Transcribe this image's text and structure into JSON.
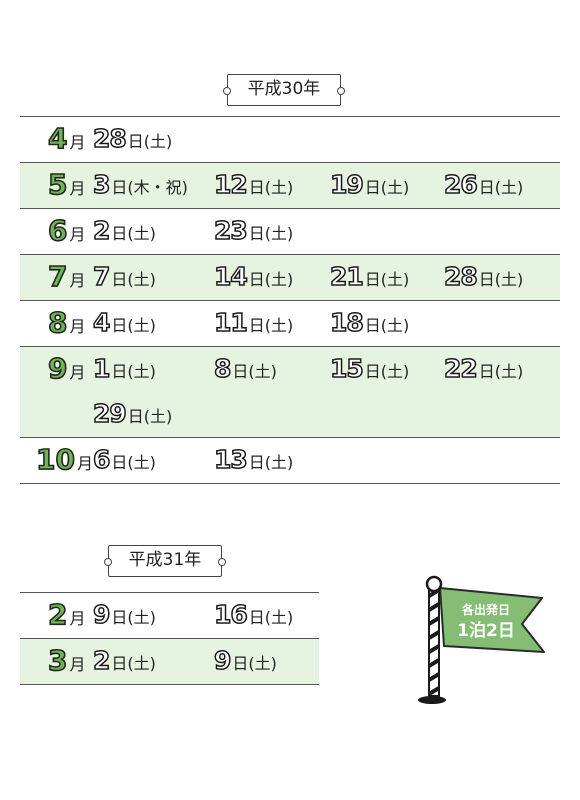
{
  "sections": [
    {
      "label": "平成30年",
      "rows": [
        {
          "month": "4",
          "month_suffix": "月",
          "shaded": false,
          "lines": [
            [
              {
                "day": "28",
                "suffix": "日(土)"
              }
            ]
          ]
        },
        {
          "month": "5",
          "month_suffix": "月",
          "shaded": true,
          "lines": [
            [
              {
                "day": "3",
                "suffix": "日(木・祝)"
              },
              {
                "day": "12",
                "suffix": "日(土)"
              },
              {
                "day": "19",
                "suffix": "日(土)"
              },
              {
                "day": "26",
                "suffix": "日(土)"
              }
            ]
          ]
        },
        {
          "month": "6",
          "month_suffix": "月",
          "shaded": false,
          "lines": [
            [
              {
                "day": "2",
                "suffix": "日(土)"
              },
              {
                "day": "23",
                "suffix": "日(土)"
              }
            ]
          ]
        },
        {
          "month": "7",
          "month_suffix": "月",
          "shaded": true,
          "lines": [
            [
              {
                "day": "7",
                "suffix": "日(土)"
              },
              {
                "day": "14",
                "suffix": "日(土)"
              },
              {
                "day": "21",
                "suffix": "日(土)"
              },
              {
                "day": "28",
                "suffix": "日(土)"
              }
            ]
          ]
        },
        {
          "month": "8",
          "month_suffix": "月",
          "shaded": false,
          "lines": [
            [
              {
                "day": "4",
                "suffix": "日(土)"
              },
              {
                "day": "11",
                "suffix": "日(土)"
              },
              {
                "day": "18",
                "suffix": "日(土)"
              }
            ]
          ]
        },
        {
          "month": "9",
          "month_suffix": "月",
          "shaded": true,
          "lines": [
            [
              {
                "day": "1",
                "suffix": "日(土)"
              },
              {
                "day": "8",
                "suffix": "日(土)"
              },
              {
                "day": "15",
                "suffix": "日(土)"
              },
              {
                "day": "22",
                "suffix": "日(土)"
              }
            ],
            [
              {
                "day": "29",
                "suffix": "日(土)"
              }
            ]
          ]
        },
        {
          "month": "10",
          "month_suffix": "月",
          "shaded": false,
          "lines": [
            [
              {
                "day": "6",
                "suffix": "日(土)"
              },
              {
                "day": "13",
                "suffix": "日(土)"
              }
            ]
          ]
        }
      ]
    },
    {
      "label": "平成31年",
      "rows": [
        {
          "month": "2",
          "month_suffix": "月",
          "shaded": false,
          "lines": [
            [
              {
                "day": "9",
                "suffix": "日(土)"
              },
              {
                "day": "16",
                "suffix": "日(土)"
              }
            ]
          ]
        },
        {
          "month": "3",
          "month_suffix": "月",
          "shaded": true,
          "lines": [
            [
              {
                "day": "2",
                "suffix": "日(土)"
              },
              {
                "day": "9",
                "suffix": "日(土)"
              }
            ]
          ]
        }
      ]
    }
  ],
  "flag": {
    "line1": "各出発日",
    "line2": "1泊2日",
    "color": "#84bd73"
  },
  "colors": {
    "row_shade": "#e7f3e1",
    "month_green": "#72b25c"
  }
}
